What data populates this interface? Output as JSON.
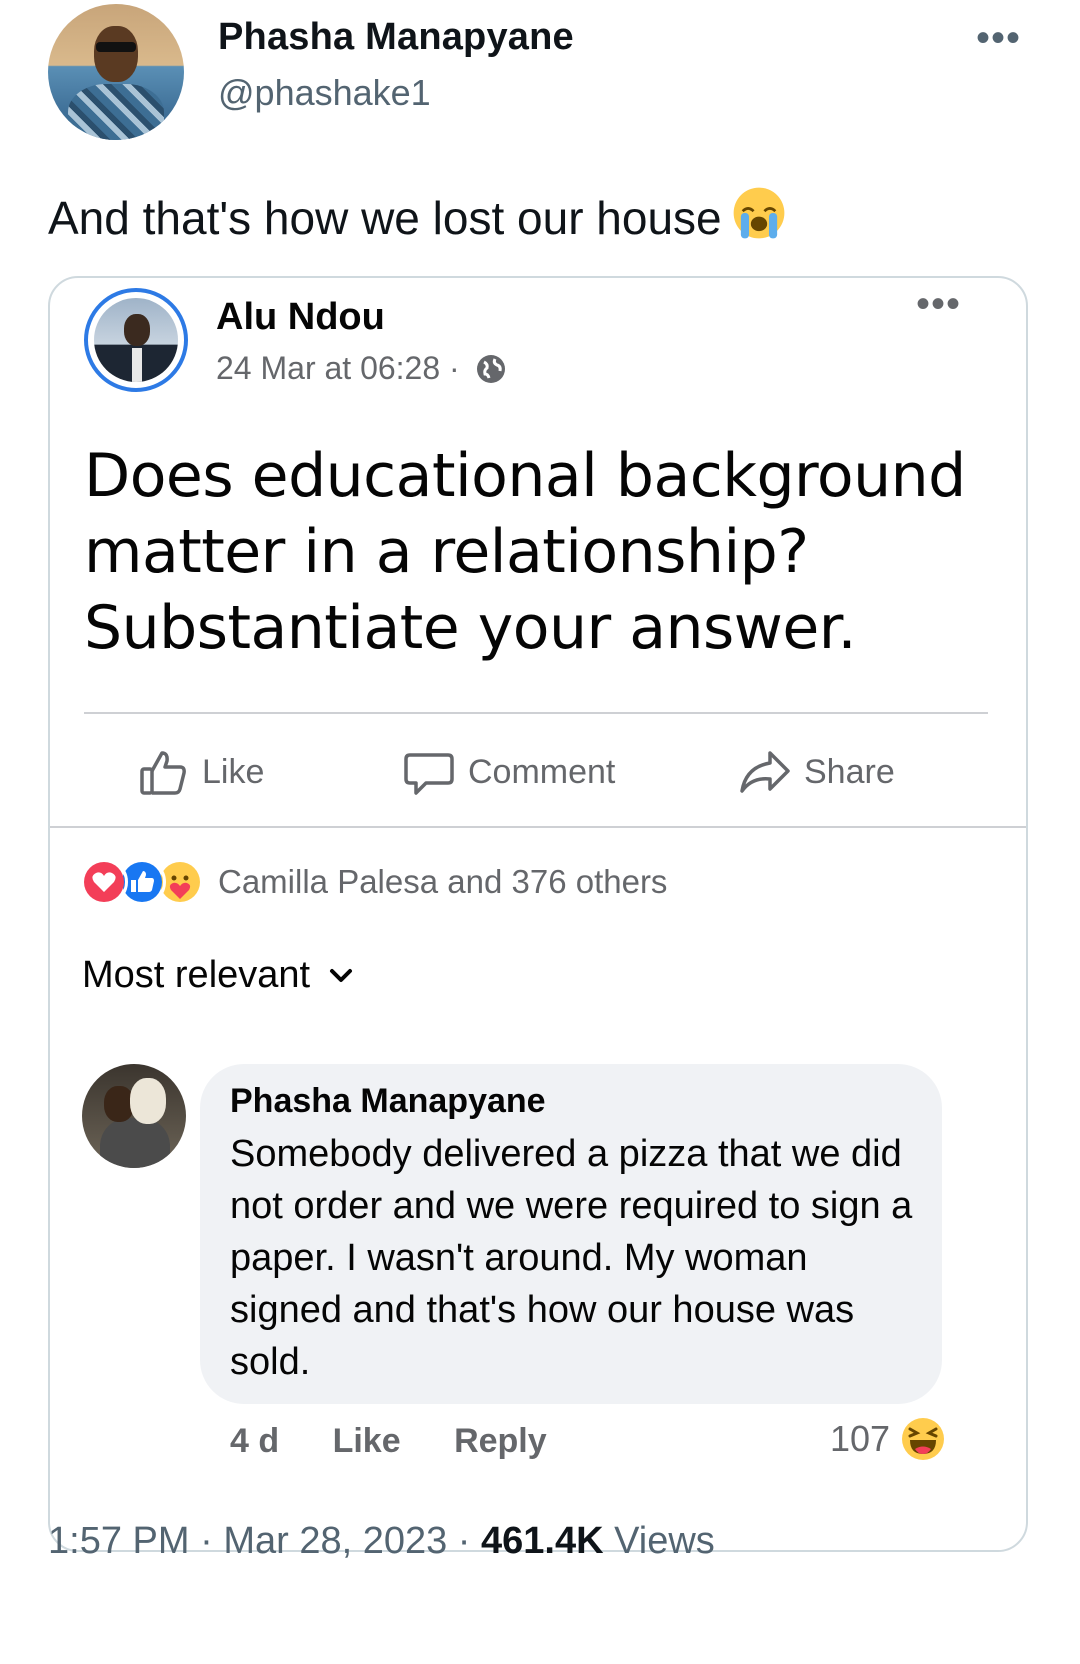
{
  "tweet": {
    "author_name": "Phasha Manapyane",
    "author_handle": "@phashake1",
    "more_icon": "more-dots-icon",
    "text": "And that's how we lost our house",
    "emoji": "loudly-crying-face-icon",
    "time": "1:57 PM",
    "date": "Mar 28, 2023",
    "views_count": "461.4K",
    "views_label": "Views",
    "sep": "·"
  },
  "fb_post": {
    "author_name": "Alu Ndou",
    "timestamp": "24 Mar at 06:28",
    "dot": "·",
    "privacy_icon": "globe-icon",
    "text": "Does educational background matter in a relationship? Substantiate your answer.",
    "actions": {
      "like": "Like",
      "comment": "Comment",
      "share": "Share"
    },
    "reactions": {
      "icons": [
        "love-react-icon",
        "like-react-icon",
        "care-react-icon"
      ],
      "summary": "Camilla Palesa and 376 others"
    },
    "sort_label": "Most relevant"
  },
  "comment": {
    "author_name": "Phasha Manapyane",
    "text": "Somebody delivered a pizza that we did not order and we were required to sign a paper. I wasn't around. My woman signed and that's how our house was sold.",
    "age": "4 d",
    "like_label": "Like",
    "reply_label": "Reply",
    "reaction_count": "107",
    "reaction_icon": "haha-react-icon"
  },
  "colors": {
    "fb_blue": "#1877f2",
    "love_red": "#f33e58",
    "secondary_text": "#65676b",
    "twitter_secondary": "#536471"
  }
}
